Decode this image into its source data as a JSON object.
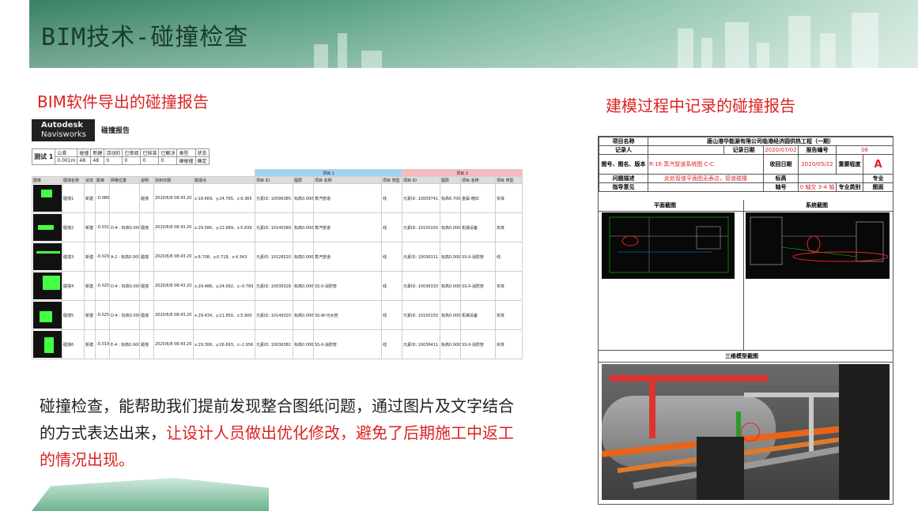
{
  "header": {
    "title": "BIM技术-碰撞检查"
  },
  "left": {
    "subtitle": "BIM软件导出的碰撞报告",
    "logo": {
      "line1": "Autodesk",
      "line2": "Navisworks"
    },
    "report_title": "碰撞报告",
    "summary": {
      "test_name": "测试 1",
      "headers": [
        "公差",
        "碰撞",
        "新建",
        "活动的",
        "已审阅",
        "已核准",
        "已解决",
        "类型",
        "状态"
      ],
      "values": [
        "0.001m",
        "48",
        "48",
        "0",
        "0",
        "0",
        "0",
        "硬碰撞",
        "确定"
      ]
    },
    "group1": "项目 1",
    "group2": "项目 2",
    "columns": [
      "图像",
      "碰撞名称",
      "状态",
      "距离",
      "网格位置",
      "说明",
      "找到日期",
      "碰撞点",
      "项目 ID",
      "图层",
      "项目 名称",
      "项目 类型",
      "项目 ID",
      "图层",
      "项目 名称",
      "项目 类型"
    ],
    "rows": [
      [
        "碰撞1",
        "新建",
        "-0.080",
        "",
        "碰撞",
        "2020/6/8 08:43.20",
        "x:18.669、y:24.765、z:9.365",
        "元素ID: 10096385",
        "标高0.000",
        "蒸汽管道",
        "线",
        "元素ID: 10009741",
        "标高6.700",
        "金属-暗红",
        "实体"
      ],
      [
        "碰撞2",
        "新建",
        "-0.031",
        "D-4 : 标高0.000",
        "碰撞",
        "2020/6/8 08:43.20",
        "x:29.580、y:22.689、z:5.839",
        "元素ID: 10140389",
        "标高0.000",
        "蒸汽管道",
        "线",
        "元素ID: 10150150",
        "标高0.000",
        "机械设备",
        "实体"
      ],
      [
        "碰撞3",
        "新建",
        "-0.029",
        "A-2 : 标高0.000",
        "碰撞",
        "2020/6/8 08:43.20",
        "x:6.708、y:0.718、z:4.343",
        "元素ID: 10128520",
        "标高0.000",
        "蒸汽管道",
        "线",
        "元素ID: 10036311",
        "标高0.000",
        "SS-X-消防管",
        "线"
      ],
      [
        "碰撞4",
        "新建",
        "-0.025",
        "D-4 : 标高0.000",
        "碰撞",
        "2020/6/8 08:43.20",
        "x:29.486、y:24.092、z:-0.769",
        "元素ID: 10036328",
        "标高0.000",
        "SS-X-消防管",
        "线",
        "元素ID: 10036333",
        "标高0.000",
        "SS-X-消防管",
        "实体"
      ],
      [
        "碰撞5",
        "新建",
        "-0.025",
        "D-4 : 标高0.000",
        "碰撞",
        "2020/6/8 08:43.20",
        "x:29.434、y:21.850、z:5.900",
        "元素ID: 10140320",
        "标高0.000",
        "SS-W-污水管",
        "线",
        "元素ID: 10150150",
        "标高0.000",
        "机械设备",
        "实体"
      ],
      [
        "碰撞6",
        "新建",
        "-0.019",
        "E-4 : 标高0.000",
        "碰撞",
        "2020/6/8 08:43.20",
        "x:29.306、y:26.693、z:-2.956",
        "元素ID: 10036381",
        "标高0.000",
        "SS-X-消防管",
        "线",
        "元素ID: 10036411",
        "标高0.000",
        "SS-X-消防管",
        "实体"
      ]
    ]
  },
  "paragraph": {
    "part1": "碰撞检查，能帮助我们提前发现整合图纸问题，通过图片及文字结合的方式表达出来，",
    "part2": "让设计人员做出优化修改，避免了后期施工中返工的情况出现。"
  },
  "right": {
    "subtitle": "建模过程中记录的碰撞报告",
    "labels": {
      "project_name": "项目名称",
      "recorder": "记录人",
      "record_date": "记录日期",
      "report_no": "报告编号",
      "drawing": "图号、图名、版本",
      "receive_date": "收回日期",
      "severity": "重要程度",
      "issue": "问题描述",
      "elevation": "标高",
      "guidance": "指导意见",
      "axis": "轴号",
      "discipline": "专业类别",
      "plan": "平面截图",
      "system": "系统截图",
      "model": "三维模型截图"
    },
    "values": {
      "project_name": "唐山港华能源有限公司临港经济园供热工程（一期）",
      "record_date": "2020/07/02",
      "report_no": "06",
      "drawing": "R-16 蒸汽管道系统图 C-C",
      "receive_date": "2020/05/22",
      "severity": "A",
      "issue": "此处管道平面图无表达，管道碰撞",
      "axis": "0 轴交 3-4 轴",
      "discipline_top": "专业",
      "discipline_bottom": "图面"
    }
  }
}
